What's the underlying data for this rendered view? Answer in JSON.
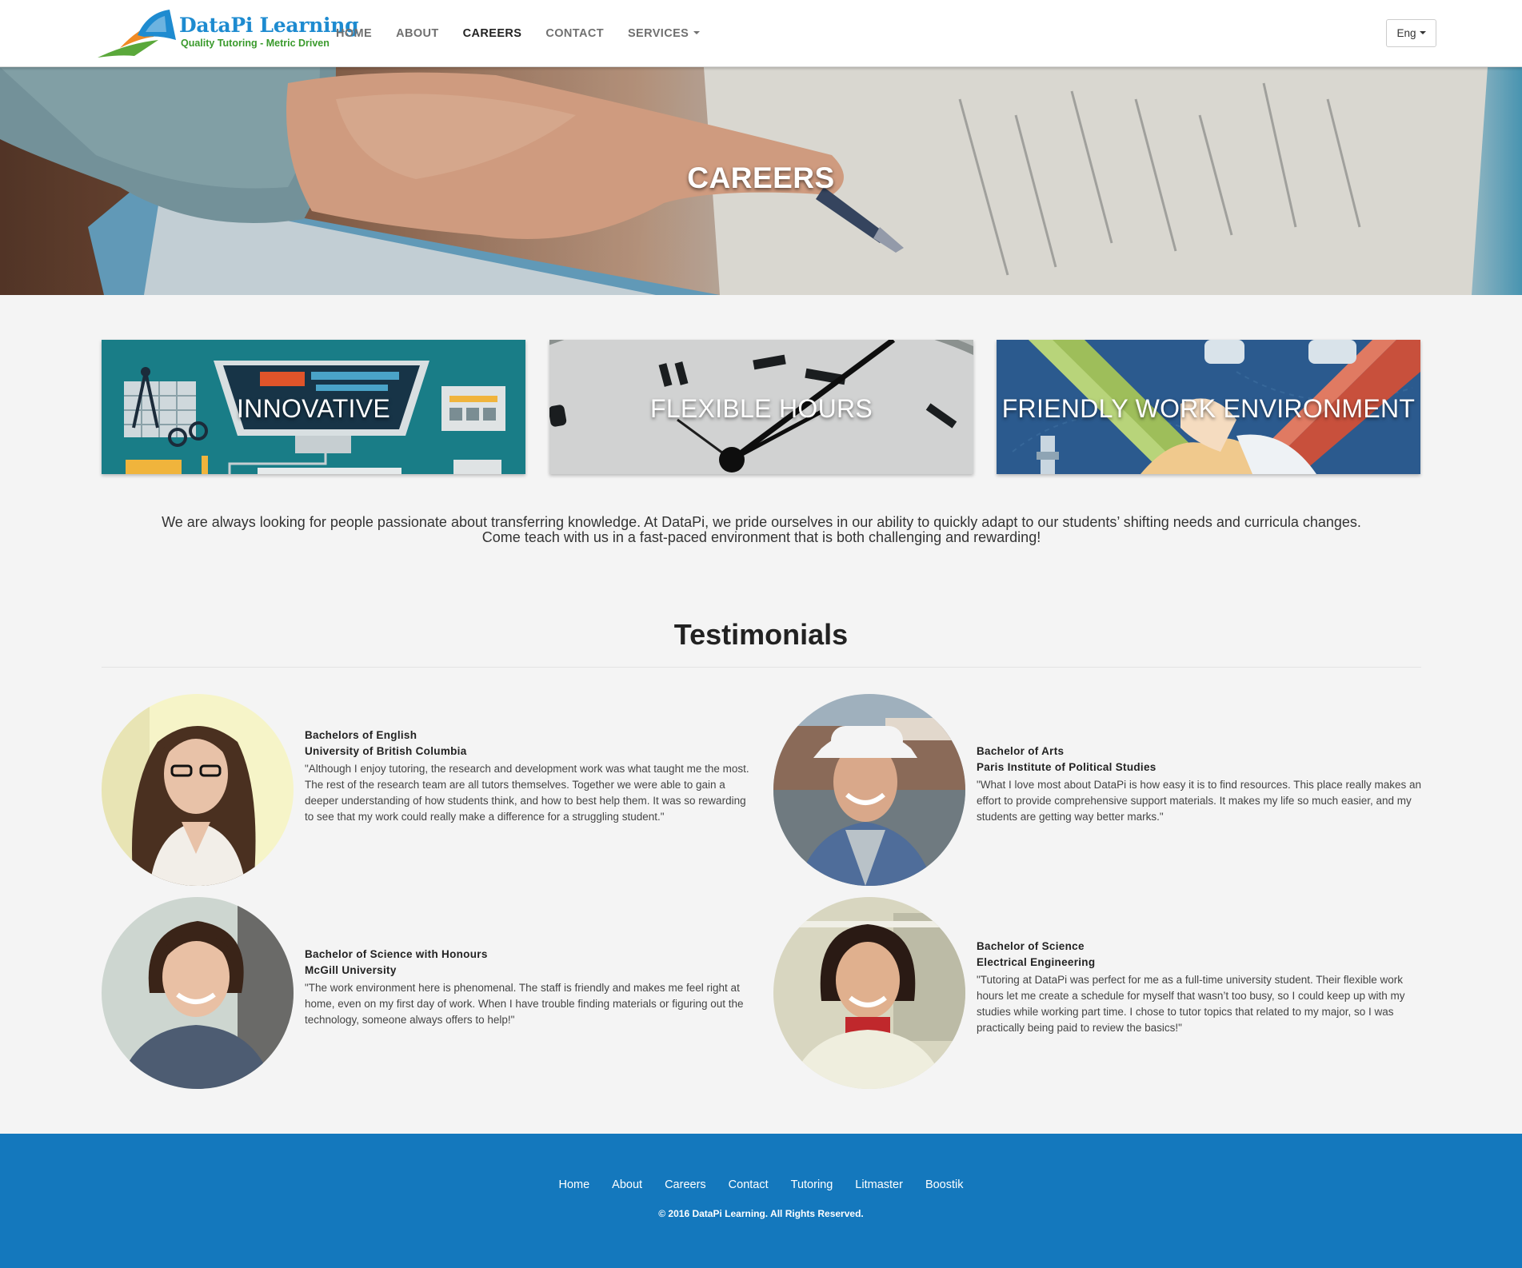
{
  "brand": {
    "name": "DataPi Learning",
    "tagline": "Quality Tutoring - Metric Driven",
    "colors": {
      "primary": "#1e8bd0",
      "green": "#3a9a2c",
      "orange": "#f08a24",
      "footer": "#1478bd"
    }
  },
  "nav": {
    "items": [
      {
        "label": "HOME"
      },
      {
        "label": "ABOUT"
      },
      {
        "label": "CAREERS",
        "active": true
      },
      {
        "label": "CONTACT"
      },
      {
        "label": "SERVICES",
        "dropdown": true
      }
    ],
    "language": "Eng"
  },
  "hero": {
    "title": "CAREERS"
  },
  "features": [
    {
      "label": "INNOVATIVE"
    },
    {
      "label": "FLEXIBLE HOURS"
    },
    {
      "label": "FRIENDLY WORK ENVIRONMENT"
    }
  ],
  "intro": {
    "line1": "We are always looking for people passionate about transferring knowledge. At DataPi, we pride ourselves in our ability to quickly adapt to our students’ shifting needs and curricula changes.",
    "line2": "Come teach with us in a fast-paced environment that is both challenging and rewarding!"
  },
  "testimonials": {
    "title": "Testimonials",
    "items": [
      {
        "degree": "Bachelors of English",
        "school": "University of British Columbia",
        "quote": "\"Although I enjoy tutoring, the research and development work was what taught me the most. The rest of the research team are all tutors themselves. Together we were able to gain a deeper understanding of how students think, and how to best help them. It was so rewarding to see that my work could really make a difference for a struggling student.\""
      },
      {
        "degree": "Bachelor of Arts",
        "school": "Paris Institute of Political Studies",
        "quote": "\"What I love most about DataPi is how easy it is to find resources. This place really makes an effort to provide comprehensive support materials. It makes my life so much easier, and my students are getting way better marks.\""
      },
      {
        "degree": "Bachelor of Science with Honours",
        "school": "McGill University",
        "quote": "\"The work environment here is phenomenal. The staff is friendly and makes me feel right at home, even on my first day of work. When I have trouble finding materials or figuring out the technology, someone always offers to help!\""
      },
      {
        "degree": "Bachelor of Science",
        "school": "Electrical Engineering",
        "quote": "\"Tutoring at DataPi was perfect for me as a full-time university student. Their flexible work hours let me create a schedule for myself that wasn’t too busy, so I could keep up with my studies while working part time. I chose to tutor topics that related to my major, so I was practically being paid to review the basics!\""
      }
    ]
  },
  "footer": {
    "links": [
      {
        "label": "Home"
      },
      {
        "label": "About"
      },
      {
        "label": "Careers"
      },
      {
        "label": "Contact"
      },
      {
        "label": "Tutoring"
      },
      {
        "label": "Litmaster"
      },
      {
        "label": "Boostik"
      }
    ],
    "copyright": "© 2016 DataPi Learning. All Rights Reserved."
  }
}
